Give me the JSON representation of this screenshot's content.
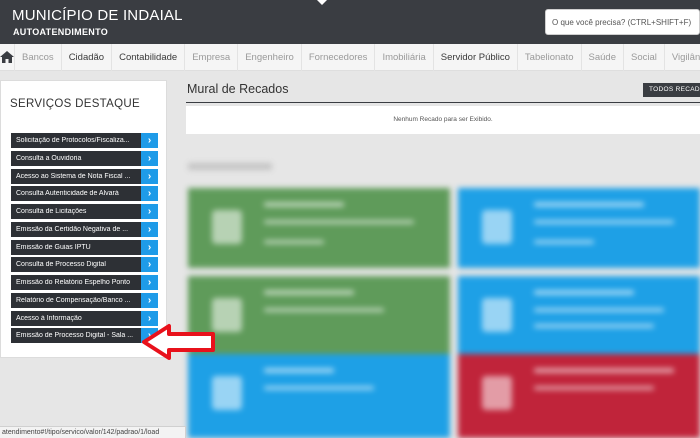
{
  "header": {
    "title": "MUNICÍPIO DE INDAIAL",
    "subtitle": "AUTOATENDIMENTO",
    "search_placeholder": "O que você precisa? (CTRL+SHIFT+F)"
  },
  "nav": {
    "items": [
      {
        "label": "Bancos",
        "active": false
      },
      {
        "label": "Cidadão",
        "active": true
      },
      {
        "label": "Contabilidade",
        "active": true
      },
      {
        "label": "Empresa",
        "active": false
      },
      {
        "label": "Engenheiro",
        "active": false
      },
      {
        "label": "Fornecedores",
        "active": false
      },
      {
        "label": "Imobiliária",
        "active": false
      },
      {
        "label": "Servidor Público",
        "active": true
      },
      {
        "label": "Tabelionato",
        "active": false
      },
      {
        "label": "Saúde",
        "active": false
      },
      {
        "label": "Social",
        "active": false
      },
      {
        "label": "Vigilância",
        "active": false
      }
    ]
  },
  "sidebar": {
    "title": "SERVIÇOS DESTAQUE",
    "items": [
      "Solicitação de Protocolos/Fiscaliza...",
      "Consulta a Ouvidoria",
      "Acesso ao Sistema de Nota Fiscal ...",
      "Consulta Autenticidade de Alvará",
      "Consulta de Licitações",
      "Emissão da Certidão Negativa de ...",
      "Emissão de Guias IPTU",
      "Consulta de Processo Digital",
      "Emissão do Relatório Espelho Ponto",
      "Relatório de Compensação/Banco ...",
      "Acesso à Informação",
      "Emissão de Processo Digital - Sala ..."
    ]
  },
  "mural": {
    "title": "Mural de Recados",
    "todos_label": "TODOS RECADOS",
    "empty_message": "Nenhum Recado para ser Exibido."
  },
  "status_bar": {
    "url": "atendimento#!/tipo/servico/valor/142/padrao/1/load"
  },
  "colors": {
    "header_bg": "#3a3d42",
    "accent_blue": "#1e9be8",
    "tile_green": "#5f9b5a",
    "tile_blue": "#1ea0e6",
    "tile_red": "#c0243a",
    "arrow_red": "#e8111b"
  }
}
